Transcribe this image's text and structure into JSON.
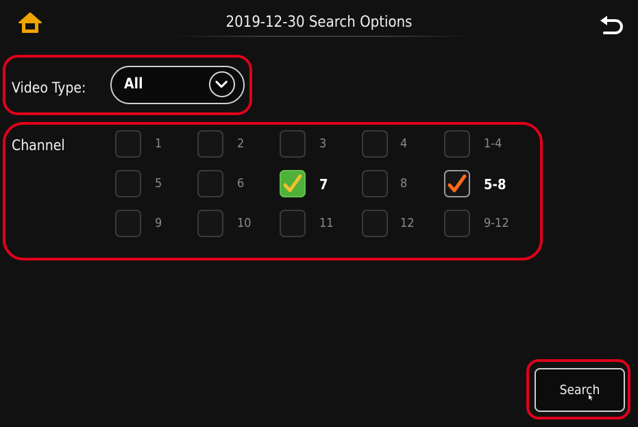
{
  "header": {
    "title": "2019-12-30 Search Options",
    "home_icon": "home-icon",
    "back_icon": "back-arrow-icon",
    "accent_color": "#f0a400"
  },
  "video_type": {
    "label": "Video Type:",
    "value": "All",
    "dropdown_icon": "chevron-down-icon"
  },
  "channel": {
    "label": "Channel",
    "options": [
      {
        "label": "1",
        "checked": false
      },
      {
        "label": "2",
        "checked": false
      },
      {
        "label": "3",
        "checked": false
      },
      {
        "label": "4",
        "checked": false
      },
      {
        "label": "1-4",
        "checked": false
      },
      {
        "label": "5",
        "checked": false
      },
      {
        "label": "6",
        "checked": false
      },
      {
        "label": "7",
        "checked": true
      },
      {
        "label": "8",
        "checked": false
      },
      {
        "label": "5-8",
        "checked": true
      },
      {
        "label": "9",
        "checked": false
      },
      {
        "label": "10",
        "checked": false
      },
      {
        "label": "11",
        "checked": false
      },
      {
        "label": "12",
        "checked": false
      },
      {
        "label": "9-12",
        "checked": false
      }
    ]
  },
  "actions": {
    "search_label": "Search"
  },
  "colors": {
    "highlight": "#e0001b",
    "checked_green": "#4fb03a",
    "checkmark": "#f0a400"
  }
}
